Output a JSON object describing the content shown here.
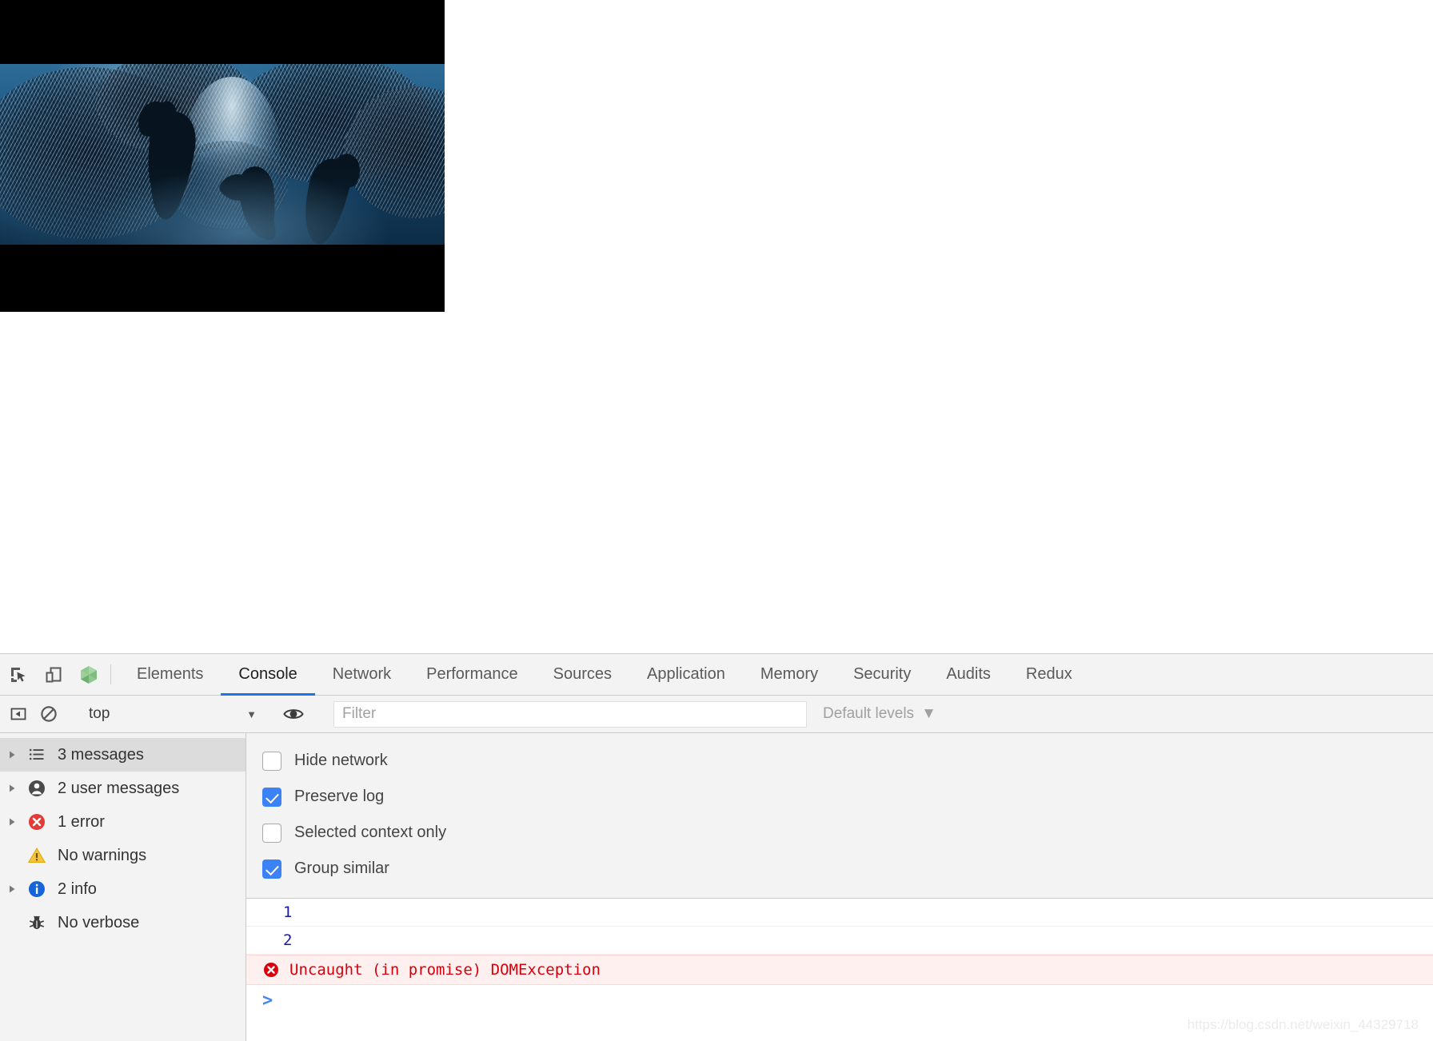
{
  "page": {
    "media": {
      "type": "video",
      "alt": "Underwater scene: dolphins hunting a large school of sardines",
      "letterboxed": true
    }
  },
  "devtools": {
    "toolbar_icons": [
      {
        "name": "inspect-element-icon",
        "title": "Select an element in the page to inspect it"
      },
      {
        "name": "device-toolbar-icon",
        "title": "Toggle device toolbar"
      },
      {
        "name": "vue-devtools-icon",
        "title": "Vue"
      }
    ],
    "tabs": [
      {
        "label": "Elements",
        "active": false
      },
      {
        "label": "Console",
        "active": true
      },
      {
        "label": "Network",
        "active": false
      },
      {
        "label": "Performance",
        "active": false
      },
      {
        "label": "Sources",
        "active": false
      },
      {
        "label": "Application",
        "active": false
      },
      {
        "label": "Memory",
        "active": false
      },
      {
        "label": "Security",
        "active": false
      },
      {
        "label": "Audits",
        "active": false
      },
      {
        "label": "Redux",
        "active": false
      }
    ],
    "filterbar": {
      "sidebar_toggle_icon": "show-console-sidebar-icon",
      "clear_console_icon": "clear-console-icon",
      "context_value": "top",
      "context_caret": "▼",
      "eye_icon": "live-expression-eye-icon",
      "filter_placeholder": "Filter",
      "filter_value": "",
      "levels_label": "Default levels",
      "levels_caret": "▼"
    },
    "sidebar": [
      {
        "label": "3 messages",
        "icon": "list-icon",
        "expandable": true,
        "selected": true
      },
      {
        "label": "2 user messages",
        "icon": "user-icon",
        "expandable": true,
        "selected": false
      },
      {
        "label": "1 error",
        "icon": "error-icon",
        "expandable": true,
        "selected": false
      },
      {
        "label": "No warnings",
        "icon": "warning-icon",
        "expandable": false,
        "selected": false
      },
      {
        "label": "2 info",
        "icon": "info-icon",
        "expandable": true,
        "selected": false
      },
      {
        "label": "No verbose",
        "icon": "verbose-bug-icon",
        "expandable": false,
        "selected": false
      }
    ],
    "settings": [
      {
        "label": "Hide network",
        "checked": false
      },
      {
        "label": "Preserve log",
        "checked": true
      },
      {
        "label": "Selected context only",
        "checked": false
      },
      {
        "label": "Group similar",
        "checked": true
      }
    ],
    "console_messages": [
      {
        "kind": "log",
        "text": "1"
      },
      {
        "kind": "log",
        "text": "2"
      },
      {
        "kind": "error",
        "text": "Uncaught (in promise) DOMException"
      }
    ],
    "prompt": ">"
  },
  "watermark": "https://blog.csdn.net/weixin_44329718",
  "colors": {
    "accent_blue": "#1a73e8",
    "checkbox_blue": "#3b82f6",
    "error_red": "#d8000c",
    "error_bg": "#fff0f0",
    "log_blue": "#1a1aa6",
    "panel_bg": "#f3f3f3",
    "selected_bg": "#dcdcdc"
  }
}
